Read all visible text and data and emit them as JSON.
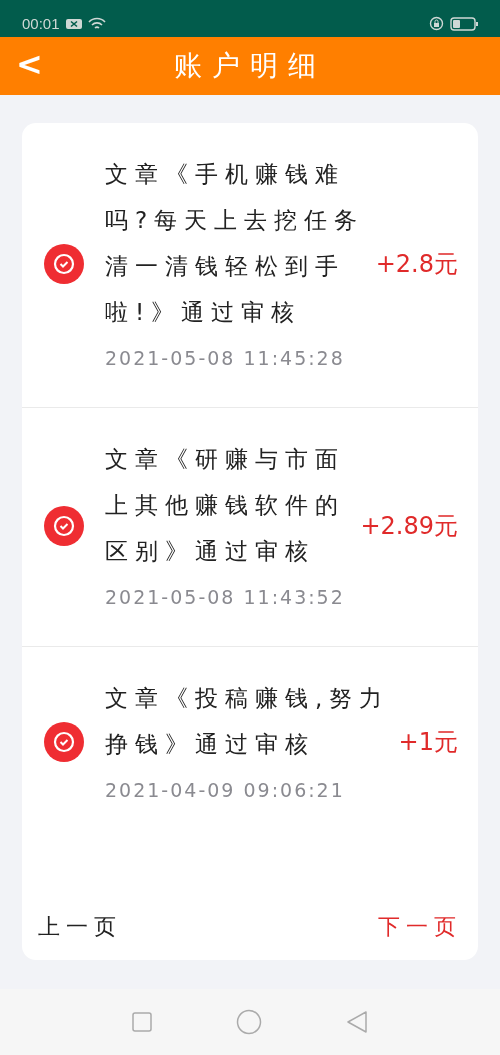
{
  "status_bar": {
    "time": "00:01"
  },
  "header": {
    "back": "<",
    "title": "账户明细"
  },
  "records": [
    {
      "text": "文章《手机赚钱难吗?每天上去挖任务清一清钱轻松到手啦!》通过审核",
      "time": "2021-05-08 11:45:28",
      "amount": "+2.8元"
    },
    {
      "text": "文章《研赚与市面上其他赚钱软件的区别》通过审核",
      "time": "2021-05-08 11:43:52",
      "amount": "+2.89元"
    },
    {
      "text": "文章《投稿赚钱,努力挣钱》通过审核",
      "time": "2021-04-09 09:06:21",
      "amount": "+1元"
    }
  ],
  "pager": [
    {
      "label": "上一页",
      "highlighted": false
    },
    {
      "label": "下一页",
      "highlighted": true
    }
  ]
}
